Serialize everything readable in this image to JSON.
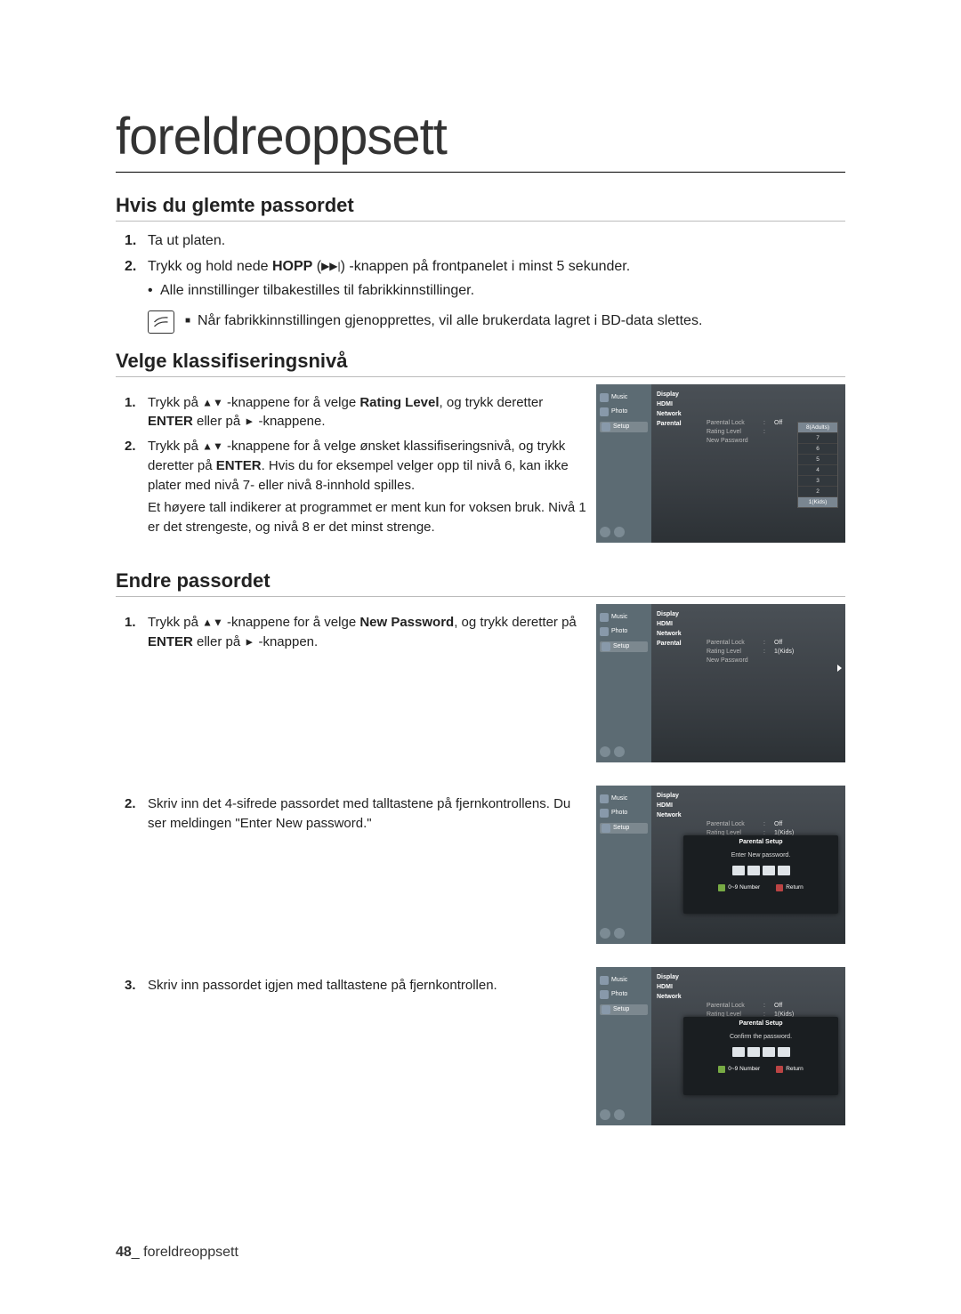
{
  "page_title": "foreldreoppsett",
  "sections": {
    "forgot": {
      "heading": "Hvis du glemte passordet",
      "step1": "Ta ut platen.",
      "step2_a": "Trykk og hold nede ",
      "step2_bold": "HOPP",
      "step2_b": " (",
      "step2_icon": "▶▶|",
      "step2_c": ") -knappen på frontpanelet i minst 5 sekunder.",
      "step2_sub": "Alle innstillinger tilbakestilles til fabrikkinnstillinger.",
      "note": "Når fabrikkinnstillingen gjenopprettes, vil alle brukerdata lagret i BD-data slettes."
    },
    "rating": {
      "heading": "Velge klassifiseringsnivå",
      "step1_a": "Trykk på ",
      "step1_arrows": "▲▼",
      "step1_b": " -knappene for å velge ",
      "step1_bold": "Rating Level",
      "step1_c": ", og trykk deretter ",
      "step1_bold2": "ENTER",
      "step1_d": " eller på ",
      "step1_play": "►",
      "step1_e": " -knappene.",
      "step2_a": "Trykk på ",
      "step2_arrows": "▲▼",
      "step2_b": " -knappene for å velge ønsket klassifiseringsnivå, og trykk deretter på ",
      "step2_bold": "ENTER",
      "step2_c": ". Hvis du for eksempel velger opp til nivå 6, kan ikke plater med nivå 7- eller nivå 8-innhold spilles.",
      "step2_para": "Et høyere tall indikerer at programmet er ment kun for voksen bruk. Nivå 1 er det strengeste, og nivå 8 er det minst strenge."
    },
    "password": {
      "heading": "Endre passordet",
      "step1_a": "Trykk på ",
      "step1_arrows": "▲▼",
      "step1_b": " -knappene for å velge ",
      "step1_bold": "New Password",
      "step1_c": ", og trykk deretter på ",
      "step1_bold2": "ENTER",
      "step1_d": " eller på ",
      "step1_play": "►",
      "step1_e": " -knappen.",
      "step2": "Skriv inn det 4-sifrede passordet med talltastene på fjernkontrollens. Du ser meldingen \"Enter New password.\"",
      "step3": "Skriv inn passordet igjen med talltastene på fjernkontrollen."
    }
  },
  "screenshot_common": {
    "left_items": [
      "Music",
      "Photo",
      "Setup"
    ],
    "right_menu": [
      "Display",
      "HDMI",
      "Network",
      "Parental"
    ],
    "col2_labels": [
      "Parental Lock",
      "Rating Level",
      "New Password"
    ],
    "off": "Off"
  },
  "dropdown": {
    "items": [
      "8(Adults)",
      "7",
      "6",
      "5",
      "4",
      "3",
      "2",
      "1(Kids)"
    ]
  },
  "ss2": {
    "rating_value": "1(Kids)"
  },
  "modal": {
    "title": "Parental Setup",
    "enter_msg": "Enter New password.",
    "confirm_msg": "Confirm the password.",
    "btn_number": "0~9  Number",
    "btn_return": "Return"
  },
  "footer": {
    "page_number": "48",
    "sep": "_",
    "label": " foreldreoppsett"
  }
}
